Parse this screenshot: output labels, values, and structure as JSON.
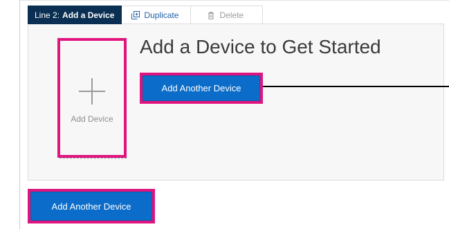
{
  "toolbar": {
    "line_prefix": "Line 2:",
    "line_title": "Add a Device",
    "duplicate_label": "Duplicate",
    "delete_label": "Delete",
    "duplicate_color": "#1f5fa8",
    "delete_color": "#9a9a9a",
    "tab_bg": "#0a2f52"
  },
  "panel": {
    "heading": "Add a Device to Get Started",
    "add_tile_label": "Add Device",
    "add_tile_icon": "plus-icon",
    "add_another_button": "Add Another Device"
  },
  "footer": {
    "add_another_button": "Add Another Device"
  },
  "colors": {
    "highlight": "#e0147f",
    "primary": "#0b6dc9",
    "heading": "#3a3a3a"
  }
}
